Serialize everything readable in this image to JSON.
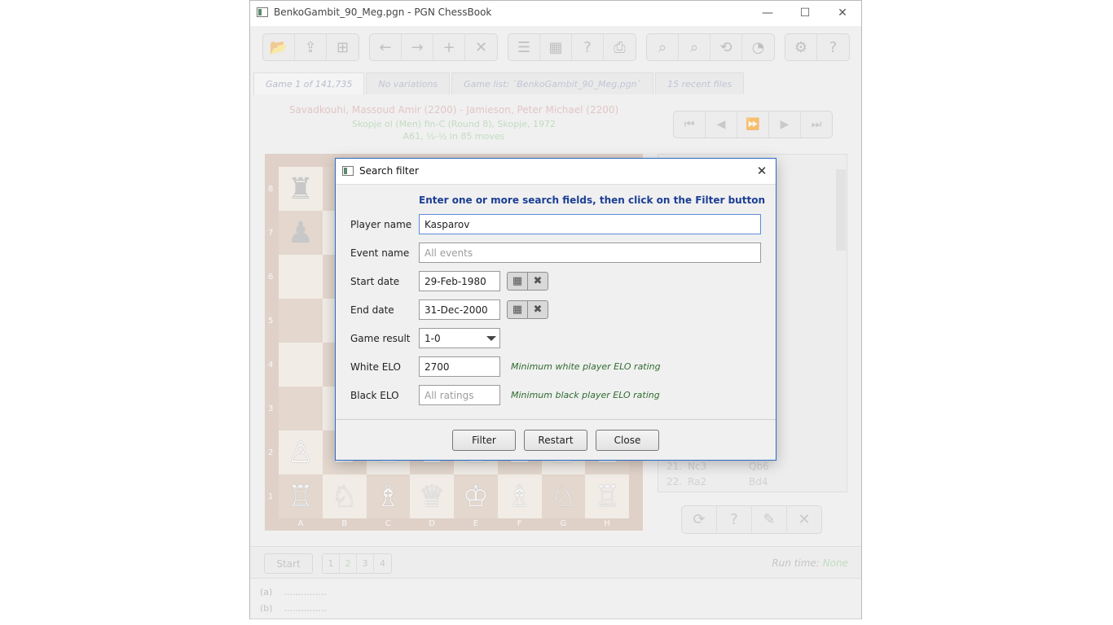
{
  "window": {
    "title": "BenkoGambit_90_Meg.pgn - PGN ChessBook",
    "minimize_icon": "—",
    "maximize_icon": "☐",
    "close_icon": "✕"
  },
  "toolbar": {
    "groups": [
      [
        {
          "icon": "folder-open-icon",
          "glyph": "📂"
        },
        {
          "icon": "save-icon",
          "glyph": "⇪"
        },
        {
          "icon": "new-file-icon",
          "glyph": "⊞"
        }
      ],
      [
        {
          "icon": "arrow-left-icon",
          "glyph": "←"
        },
        {
          "icon": "arrow-right-icon",
          "glyph": "→"
        },
        {
          "icon": "plus-icon",
          "glyph": "+"
        },
        {
          "icon": "delete-icon",
          "glyph": "✕"
        }
      ],
      [
        {
          "icon": "players-list-icon",
          "glyph": "☰"
        },
        {
          "icon": "board-icon",
          "glyph": "▦"
        },
        {
          "icon": "search-query-icon",
          "glyph": "?"
        },
        {
          "icon": "print-icon",
          "glyph": "⎙"
        }
      ],
      [
        {
          "icon": "zoom-search-icon",
          "glyph": "⌕"
        },
        {
          "icon": "advanced-search-icon",
          "glyph": "⌕"
        },
        {
          "icon": "undo-search-icon",
          "glyph": "⟲"
        },
        {
          "icon": "statistics-icon",
          "glyph": "◔"
        }
      ],
      [
        {
          "icon": "settings-icon",
          "glyph": "⚙"
        },
        {
          "icon": "help-book-icon",
          "glyph": "?"
        }
      ]
    ]
  },
  "tabs": [
    {
      "label": "Game 1 of 141,735",
      "active": true
    },
    {
      "label": "No variations",
      "active": false
    },
    {
      "label": "Game list:  `BenkoGambit_90_Meg.pgn`",
      "active": false
    },
    {
      "label": "15 recent files",
      "active": false
    }
  ],
  "game": {
    "players": "Savadkouhi, Massoud Amir (2200) - Jamieson, Peter Michael (2200)",
    "event": "Skopje ol (Men) fin-C (Round 8),  Skopje,  1972",
    "eco": "A61,  ½-½  in 85 moves"
  },
  "navigation": {
    "buttons": [
      {
        "name": "first-move-button",
        "glyph": "⏮"
      },
      {
        "name": "previous-move-button",
        "glyph": "◀"
      },
      {
        "name": "play-forward-button",
        "glyph": "⏩"
      },
      {
        "name": "next-move-button",
        "glyph": "▶"
      },
      {
        "name": "last-move-button",
        "glyph": "⏭"
      }
    ]
  },
  "board": {
    "ranks": [
      "8",
      "7",
      "6",
      "5",
      "4",
      "3",
      "2",
      "1"
    ],
    "files": [
      "A",
      "B",
      "C",
      "D",
      "E",
      "F",
      "G",
      "H"
    ],
    "pieces": {
      "8": [
        "♜",
        "♞",
        "",
        "",
        "",
        "",
        "",
        ""
      ],
      "7": [
        "♟",
        "♟",
        "",
        "",
        "",
        "",
        "",
        ""
      ],
      "6": [
        "",
        "",
        "",
        "",
        "",
        "",
        "",
        ""
      ],
      "5": [
        "",
        "",
        "",
        "",
        "",
        "",
        "",
        ""
      ],
      "4": [
        "",
        "",
        "",
        "",
        "",
        "",
        "",
        ""
      ],
      "3": [
        "",
        "",
        "",
        "",
        "",
        "",
        "",
        ""
      ],
      "2": [
        "♙",
        "♙",
        "♙",
        "♙",
        "♙",
        "♙",
        "♙",
        "♙"
      ],
      "1": [
        "♖",
        "♘",
        "♗",
        "♕",
        "♔",
        "♗",
        "♘",
        "♖"
      ]
    }
  },
  "moves": [
    {
      "num": "21.",
      "white": "Nc3",
      "black": "Qb6"
    },
    {
      "num": "22.",
      "white": "Ra2",
      "black": "Bd4"
    }
  ],
  "action_bar": {
    "buttons": [
      {
        "name": "flip-board-button",
        "glyph": "⟳"
      },
      {
        "name": "player-info-button",
        "glyph": "?"
      },
      {
        "name": "edit-button",
        "glyph": "✎"
      },
      {
        "name": "close-game-button",
        "glyph": "✕"
      }
    ]
  },
  "bottom": {
    "start_label": "Start",
    "pages": [
      "1",
      "2",
      "3",
      "4"
    ],
    "current_page": "2",
    "runtime_label": "Run time:",
    "runtime_value": "None",
    "line_a_label": "(a)",
    "line_a_value": "...............",
    "line_b_label": "(b)",
    "line_b_value": "..............."
  },
  "dialog": {
    "title": "Search filter",
    "close_icon": "✕",
    "instructions": "Enter one or more search fields, then click on the Filter button",
    "player_name": {
      "label": "Player name",
      "value": "Kasparov"
    },
    "event_name": {
      "label": "Event name",
      "placeholder": "All events"
    },
    "start_date": {
      "label": "Start date",
      "value": "29-Feb-1980"
    },
    "end_date": {
      "label": "End date",
      "value": "31-Dec-2000"
    },
    "calendar_glyph": "▦",
    "clear_glyph": "✖",
    "game_result": {
      "label": "Game result",
      "value": "1-0"
    },
    "white_elo": {
      "label": "White ELO",
      "value": "2700",
      "hint": "Minimum white player ELO rating"
    },
    "black_elo": {
      "label": "Black ELO",
      "placeholder": "All ratings",
      "hint": "Minimum black player ELO rating"
    },
    "buttons": {
      "filter": "Filter",
      "restart": "Restart",
      "close": "Close"
    }
  }
}
